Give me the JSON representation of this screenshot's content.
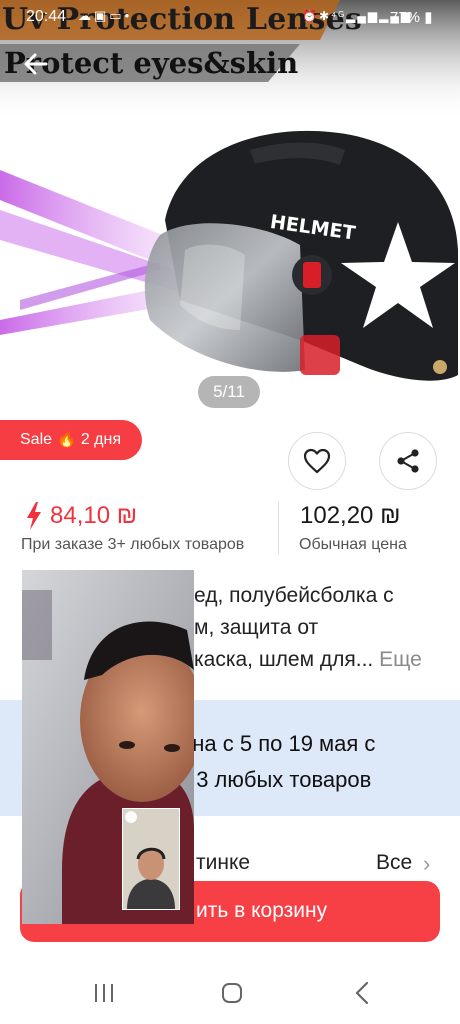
{
  "status_bar": {
    "time": "20:44",
    "battery": "77%",
    "left_icons": [
      "cloud-icon",
      "image-icon",
      "cast-icon",
      "dot-icon"
    ],
    "right_icons": [
      "alarm-icon",
      "bluetooth-icon",
      "4g-icon",
      "signal-icon",
      "signal-icon",
      "battery-icon"
    ]
  },
  "banner": {
    "line1": "Uv Protection Lenses",
    "line2": "Protect eyes&skin"
  },
  "hero": {
    "helmet_text": "HELMET",
    "image_counter": "5/11"
  },
  "sale_badge": {
    "label": "Sale 🔥 2 дня"
  },
  "price": {
    "sale_value": "84,10 ₪",
    "sale_caption": "При заказе 3+ любых товаров",
    "regular_value": "102,20 ₪",
    "regular_caption": "Обычная цена"
  },
  "description": {
    "line1": "ед, полубейсболка с",
    "line2": "м, защита от",
    "line3": "каска, шлем для...",
    "more": "Еще"
  },
  "promo": {
    "line1": "ена с 5 по 19 мая с",
    "line2": "т 3 любых товаров"
  },
  "section": {
    "title": "тинке",
    "all_label": "Все"
  },
  "cart_button": {
    "label": "ить в корзину"
  },
  "colors": {
    "accent_red": "#f53d43",
    "promo_background": "#dde8f8",
    "banner_orange": "#b5651d"
  }
}
